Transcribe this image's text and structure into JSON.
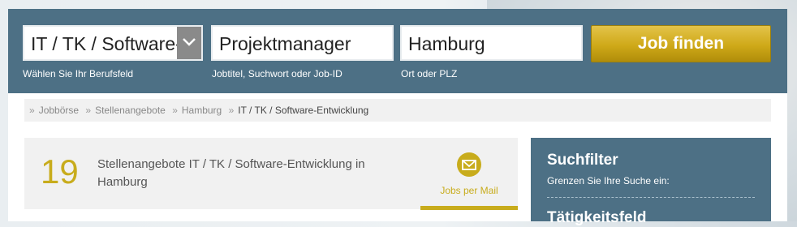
{
  "search": {
    "category_value": "IT / TK / Software-Entwicklung",
    "category_hint": "Wählen Sie Ihr Berufsfeld",
    "keyword_value": "Projektmanager",
    "keyword_hint": "Jobtitel, Suchwort oder Job-ID",
    "location_value": "Hamburg",
    "location_hint": "Ort oder PLZ",
    "submit_label": "Job finden"
  },
  "breadcrumb": {
    "separator": "»",
    "items": [
      "Jobbörse",
      "Stellenangebote",
      "Hamburg",
      "IT / TK / Software-Entwicklung"
    ]
  },
  "results": {
    "count": "19",
    "description": "Stellenangebote IT / TK / Software-Entwicklung in Hamburg",
    "mail_label": "Jobs per Mail"
  },
  "filter": {
    "title": "Suchfilter",
    "subtitle": "Grenzen Sie Ihre Suche ein:",
    "section_title": "Tätigkeitsfeld"
  },
  "colors": {
    "header_bg": "#4d7085",
    "accent_gold": "#c8ac1c",
    "button_gold": "#cfa918"
  },
  "icons": {
    "category_dropdown": "chevron-down-icon",
    "mail": "envelope-icon"
  }
}
